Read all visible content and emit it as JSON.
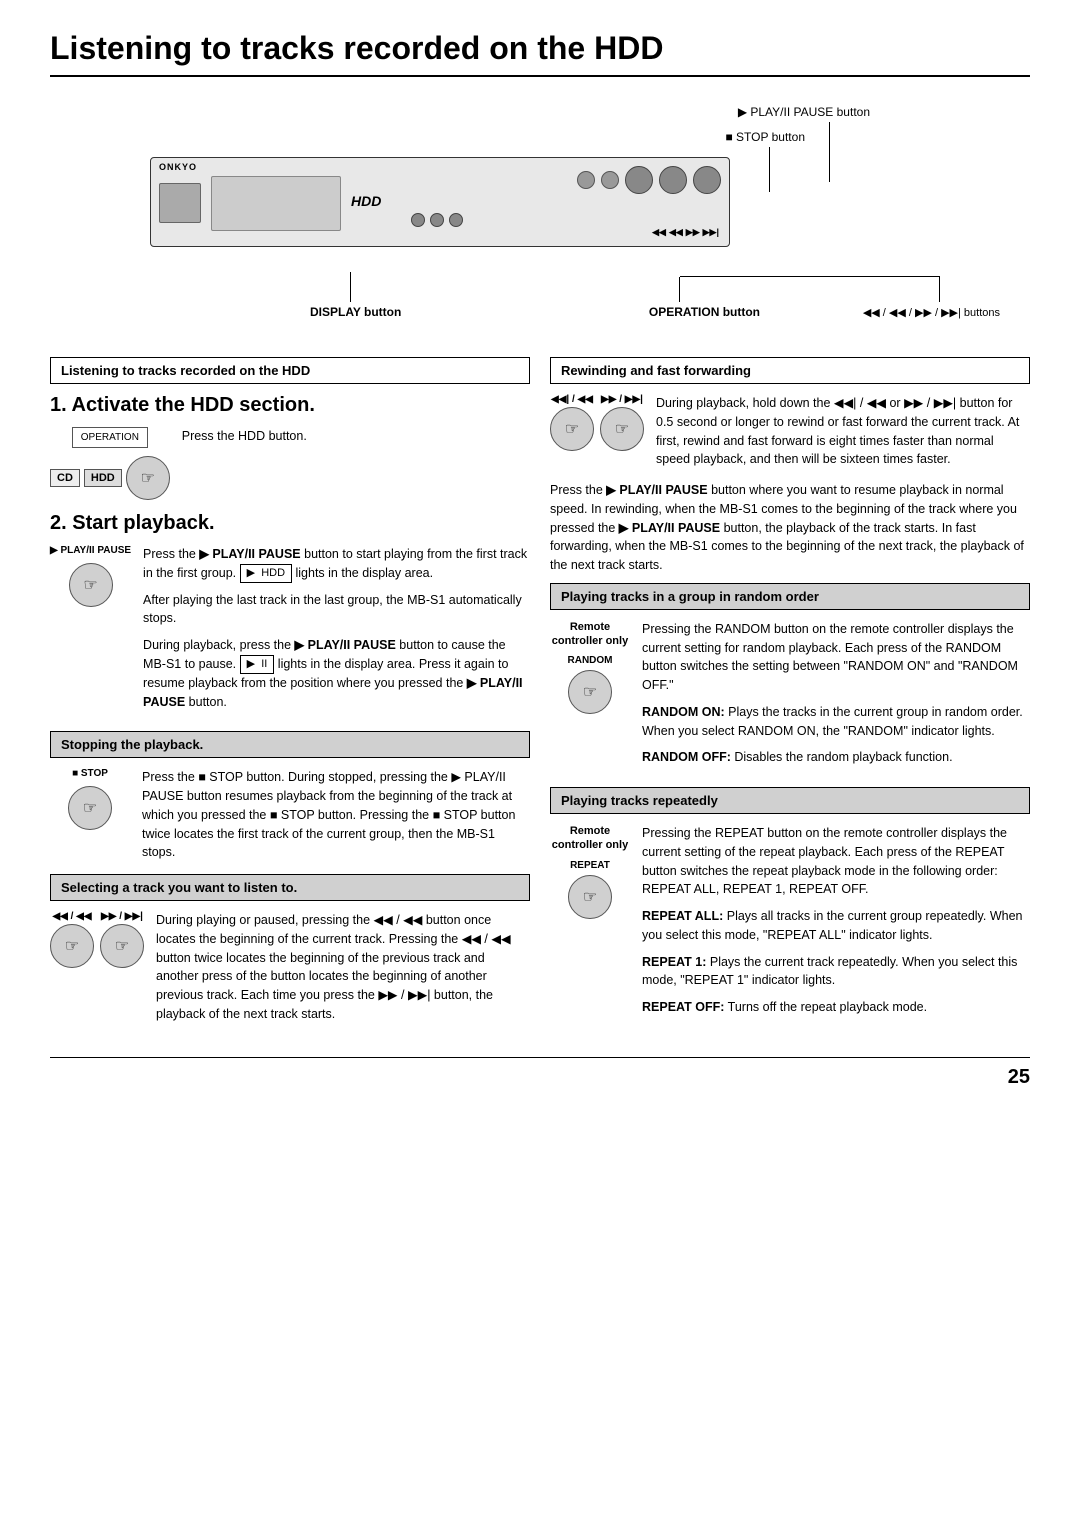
{
  "page": {
    "title": "Listening to tracks recorded on the HDD",
    "page_number": "25"
  },
  "device_annotations": {
    "play_pause_label": "▶ PLAY/II PAUSE button",
    "stop_label": "■ STOP button",
    "display_label": "DISPLAY button",
    "operation_label": "OPERATION button",
    "nav_buttons_label": "◀◀ / ◀◀ / ▶▶ / ▶▶| buttons"
  },
  "left_column": {
    "main_section_header": "Listening to tracks recorded on the HDD",
    "step1_heading": "1. Activate the HDD section.",
    "step1_operation_label": "OPERATION",
    "step1_cd_label": "CD",
    "step1_hdd_label": "HDD",
    "step1_instruction": "Press the HDD button.",
    "step2_heading": "2. Start playback.",
    "step2_play_label": "▶ PLAY/II PAUSE",
    "step2_instruction_p1": "Press the ▶ PLAY/II PAUSE button to start playing from the first track in the first group.",
    "step2_display_hdd": "HDD",
    "step2_display_suffix": "lights in the display area.",
    "step2_instruction_p2": "After playing the last track in the last group, the MB-S1 automatically stops.",
    "step2_instruction_p3": "During playback, press the ▶ PLAY/II PAUSE button to cause the MB-S1 to pause.",
    "step2_display_pause": "▶  II",
    "step2_instruction_p3b": "lights in the display area. Press it again to resume playback from the position where you pressed the ▶ PLAY/II PAUSE button.",
    "stopping_header": "Stopping the playback.",
    "stop_label": "■ STOP",
    "stopping_instruction": "Press the ■ STOP button. During stopped, pressing the ▶ PLAY/II PAUSE button resumes playback from the beginning of the track at which you pressed the ■ STOP button. Pressing the ■ STOP button twice locates the first track of the current group, then the MB-S1 stops.",
    "selecting_header": "Selecting a track you want to listen to.",
    "selecting_icons_left": "◀◀ / ◀◀",
    "selecting_icons_right": "▶▶ / ▶▶|",
    "selecting_instruction": "During playing or paused, pressing the ◀◀ / ◀◀ button once locates the beginning of the current track. Pressing the ◀◀ / ◀◀ button twice locates the beginning of the previous track and another press of the button locates the beginning of another previous track. Each time you press the ▶▶ / ▶▶| button, the playback of the next track starts."
  },
  "right_column": {
    "rewinding_header": "Rewinding and fast forwarding",
    "rewinding_icons_left": "◀◀| / ◀◀",
    "rewinding_icons_right": "▶▶ / ▶▶|",
    "rewinding_instruction": "During playback, hold down the ◀◀| / ◀◀ or ▶▶ / ▶▶| button for 0.5 second or longer to rewind or fast forward the current track. At first, rewind and fast forward is eight times faster than normal speed playback, and then will be sixteen times faster.",
    "rewinding_para1": "Press the ▶ PLAY/II PAUSE button where you want to resume playback in normal speed. In rewinding, when the MB-S1 comes to the beginning of the track where you pressed the ▶ PLAY/II PAUSE button, the playback of the track starts. In fast forwarding, when the MB-S1 comes to the beginning of the next track, the playback of the next track starts.",
    "random_header": "Playing tracks in a group in random order",
    "remote_label": "Remote\ncontroller only",
    "random_button_label": "RANDOM",
    "random_instruction": "Pressing the RANDOM button on the remote controller displays the current setting for random playback. Each press of the RANDOM button switches the setting between \"RANDOM ON\" and \"RANDOM OFF.\"",
    "random_on_label": "RANDOM ON:",
    "random_on_text": "Plays the tracks in the current group in random order. When you select RANDOM ON, the \"RANDOM\" indicator lights.",
    "random_off_label": "RANDOM OFF:",
    "random_off_text": "Disables the random playback function.",
    "repeat_header": "Playing tracks repeatedly",
    "repeat_remote_label": "Remote\ncontroller only",
    "repeat_button_label": "REPEAT",
    "repeat_instruction": "Pressing the REPEAT button on the remote controller displays the current setting of the repeat playback. Each press of the REPEAT button switches the repeat playback mode in the following order: REPEAT ALL, REPEAT 1, REPEAT OFF.",
    "repeat_all_label": "REPEAT ALL:",
    "repeat_all_text": "Plays all tracks in the current group repeatedly. When you select this mode, \"REPEAT ALL\" indicator lights.",
    "repeat_1_label": "REPEAT 1:",
    "repeat_1_text": "Plays the current track repeatedly. When you select this mode, \"REPEAT 1\" indicator lights.",
    "repeat_off_label": "REPEAT OFF:",
    "repeat_off_text": "Turns off the repeat playback mode."
  }
}
